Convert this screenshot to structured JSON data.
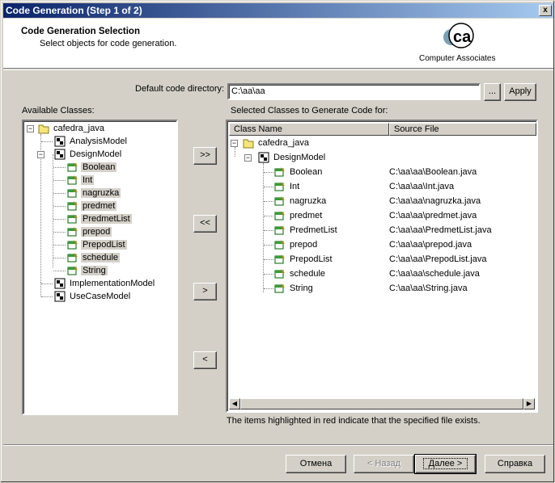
{
  "window": {
    "title": "Code Generation (Step 1 of 2)",
    "close_glyph": "x"
  },
  "header": {
    "title": "Code Generation Selection",
    "subtitle": "Select objects for code generation.",
    "logo_text": "Computer Associates",
    "logo_letters": "ca"
  },
  "directory": {
    "label": "Default code directory:",
    "value": "C:\\aa\\aa",
    "browse_label": "...",
    "apply_label": "Apply"
  },
  "available": {
    "label": "Available Classes:",
    "tree": [
      {
        "label": "cafedra_java",
        "icon": "folder-icon",
        "highlight": false
      },
      {
        "label": "AnalysisModel",
        "icon": "model-icon",
        "highlight": false
      },
      {
        "label": "DesignModel",
        "icon": "model-icon",
        "highlight": false
      },
      {
        "label": "Boolean",
        "icon": "class-icon",
        "highlight": true
      },
      {
        "label": "Int",
        "icon": "class-icon",
        "highlight": true
      },
      {
        "label": "nagruzka",
        "icon": "class-icon",
        "highlight": true
      },
      {
        "label": "predmet",
        "icon": "class-icon",
        "highlight": true
      },
      {
        "label": "PredmetList",
        "icon": "class-icon",
        "highlight": true
      },
      {
        "label": "prepod",
        "icon": "class-icon",
        "highlight": true
      },
      {
        "label": "PrepodList",
        "icon": "class-icon",
        "highlight": true
      },
      {
        "label": "schedule",
        "icon": "class-icon",
        "highlight": true
      },
      {
        "label": "String",
        "icon": "class-icon",
        "highlight": true
      },
      {
        "label": "ImplementationModel",
        "icon": "model-icon",
        "highlight": false
      },
      {
        "label": "UseCaseModel",
        "icon": "model-icon",
        "highlight": false
      }
    ]
  },
  "transfer_buttons": {
    "add_all": ">>",
    "remove_all": "<<",
    "add": ">",
    "remove": "<"
  },
  "selected": {
    "label": "Selected Classes to Generate Code for:",
    "col_class": "Class Name",
    "col_source": "Source File",
    "rows": [
      {
        "name": "cafedra_java",
        "source": "",
        "icon": "folder-icon"
      },
      {
        "name": "DesignModel",
        "source": "",
        "icon": "model-icon"
      },
      {
        "name": "Boolean",
        "source": "C:\\aa\\aa\\Boolean.java",
        "icon": "class-icon"
      },
      {
        "name": "Int",
        "source": "C:\\aa\\aa\\Int.java",
        "icon": "class-icon"
      },
      {
        "name": "nagruzka",
        "source": "C:\\aa\\aa\\nagruzka.java",
        "icon": "class-icon"
      },
      {
        "name": "predmet",
        "source": "C:\\aa\\aa\\predmet.java",
        "icon": "class-icon"
      },
      {
        "name": "PredmetList",
        "source": "C:\\aa\\aa\\PredmetList.java",
        "icon": "class-icon"
      },
      {
        "name": "prepod",
        "source": "C:\\aa\\aa\\prepod.java",
        "icon": "class-icon"
      },
      {
        "name": "PrepodList",
        "source": "C:\\aa\\aa\\PrepodList.java",
        "icon": "class-icon"
      },
      {
        "name": "schedule",
        "source": "C:\\aa\\aa\\schedule.java",
        "icon": "class-icon"
      },
      {
        "name": "String",
        "source": "C:\\aa\\aa\\String.java",
        "icon": "class-icon"
      }
    ],
    "note": "The items highlighted in red indicate that the specified file exists."
  },
  "footer": {
    "cancel": "Отмена",
    "back": "< Назад",
    "next": "Далее >",
    "help": "Справка"
  }
}
